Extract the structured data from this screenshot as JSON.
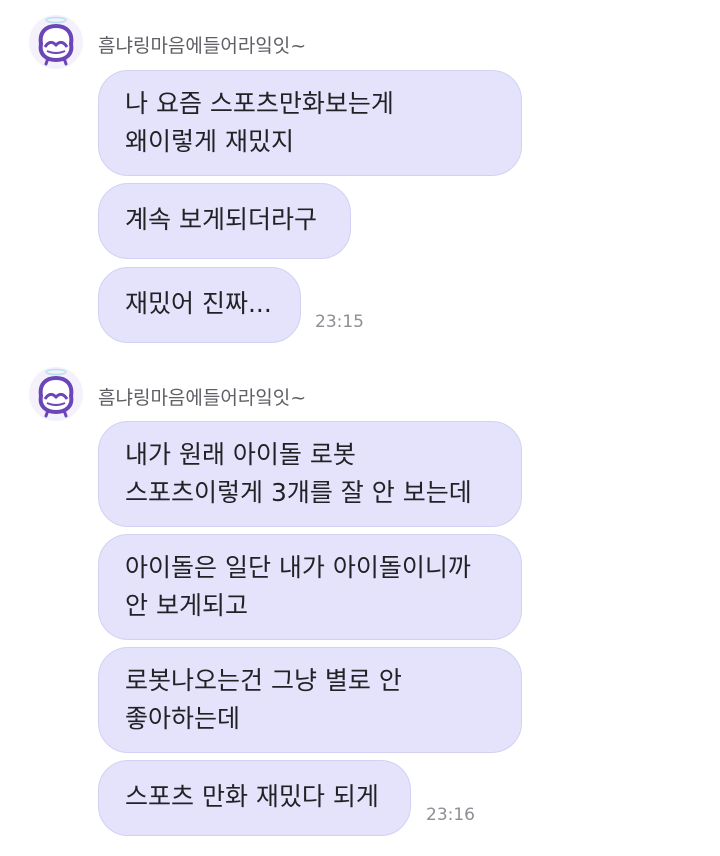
{
  "chat": {
    "groups": [
      {
        "sender": "흠냐링마음에들어라잌잇~",
        "avatar": "purple-bun-character-avatar",
        "messages": [
          {
            "lines": [
              "나 요즘 스포츠만화보는게",
              "왜이렇게 재밌지"
            ]
          },
          {
            "lines": [
              "계속 보게되더라구"
            ]
          },
          {
            "lines": [
              "재밌어 진짜..."
            ],
            "time": "23:15"
          }
        ]
      },
      {
        "sender": "흠냐링마음에들어라잌잇~",
        "avatar": "purple-bun-character-avatar",
        "messages": [
          {
            "lines": [
              "내가 원래 아이돌 로봇",
              "스포츠이렇게 3개를 잘 안 보는데"
            ]
          },
          {
            "lines": [
              "아이돌은 일단 내가 아이돌이니까",
              "안 보게되고"
            ]
          },
          {
            "lines": [
              "로봇나오는건 그냥 별로 안",
              "좋아하는데"
            ]
          },
          {
            "lines": [
              "스포츠 만화 재밌다 되게"
            ],
            "time": "23:16"
          }
        ]
      }
    ]
  },
  "colors": {
    "bubble": "#e4e3fb",
    "bubble_border": "#d2d1f3",
    "avatar_purple": "#6b46b8"
  }
}
